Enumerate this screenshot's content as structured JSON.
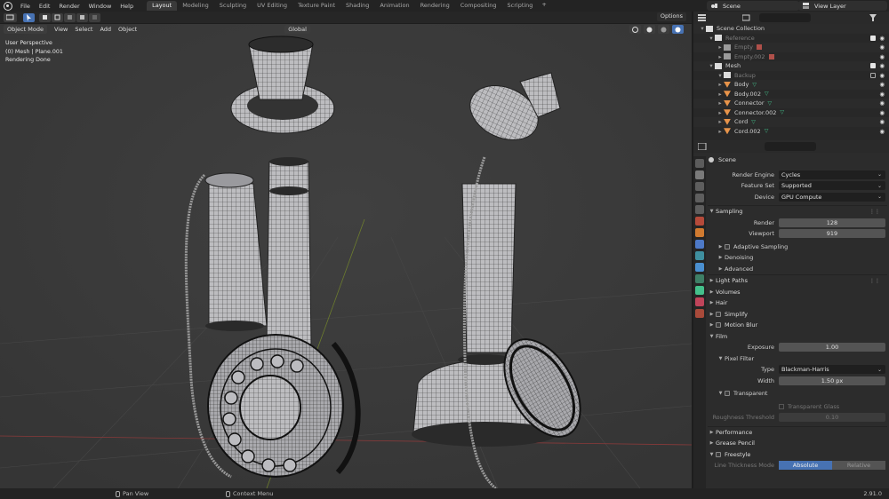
{
  "menu": [
    "File",
    "Edit",
    "Render",
    "Window",
    "Help"
  ],
  "workspaces": [
    {
      "label": "Layout",
      "active": true
    },
    {
      "label": "Modeling",
      "active": false
    },
    {
      "label": "Sculpting",
      "active": false
    },
    {
      "label": "UV Editing",
      "active": false
    },
    {
      "label": "Texture Paint",
      "active": false
    },
    {
      "label": "Shading",
      "active": false
    },
    {
      "label": "Animation",
      "active": false
    },
    {
      "label": "Rendering",
      "active": false
    },
    {
      "label": "Compositing",
      "active": false
    },
    {
      "label": "Scripting",
      "active": false
    }
  ],
  "add_tab": "+",
  "scene": "Scene",
  "view_layer": "View Layer",
  "viewport": {
    "mode": "Object Mode",
    "menus": [
      "View",
      "Select",
      "Add",
      "Object"
    ],
    "orientation": "Global",
    "options": "Options",
    "info": [
      "User Perspective",
      "(0) Mesh | Plane.001",
      "Rendering Done"
    ]
  },
  "outliner": {
    "rows": [
      {
        "label": "Scene Collection",
        "indent": 0,
        "type": "collection",
        "dim": false,
        "check": null
      },
      {
        "label": "Reference",
        "indent": 1,
        "type": "collection",
        "dim": true,
        "check": "on"
      },
      {
        "label": "Empty",
        "indent": 2,
        "type": "empty",
        "dim": true,
        "check": null
      },
      {
        "label": "Empty.002",
        "indent": 2,
        "type": "empty",
        "dim": true,
        "check": null
      },
      {
        "label": "Mesh",
        "indent": 1,
        "type": "collection",
        "dim": false,
        "check": "on"
      },
      {
        "label": "Backup",
        "indent": 2,
        "type": "collection",
        "dim": true,
        "check": "off"
      },
      {
        "label": "Body",
        "indent": 2,
        "type": "mesh",
        "dim": false,
        "check": null
      },
      {
        "label": "Body.002",
        "indent": 2,
        "type": "mesh",
        "dim": false,
        "check": null
      },
      {
        "label": "Connector",
        "indent": 2,
        "type": "mesh",
        "dim": false,
        "check": null
      },
      {
        "label": "Connector.002",
        "indent": 2,
        "type": "mesh",
        "dim": false,
        "check": null
      },
      {
        "label": "Cord",
        "indent": 2,
        "type": "mesh",
        "dim": false,
        "check": null
      },
      {
        "label": "Cord.002",
        "indent": 2,
        "type": "mesh",
        "dim": false,
        "check": null
      }
    ]
  },
  "properties": {
    "context": "Scene",
    "render_engine_label": "Render Engine",
    "render_engine": "Cycles",
    "feature_set_label": "Feature Set",
    "feature_set": "Supported",
    "device_label": "Device",
    "device": "GPU Compute",
    "sampling": "Sampling",
    "render_label": "Render",
    "render_samples": "128",
    "viewport_label": "Viewport",
    "viewport_samples": "919",
    "adaptive_sampling": "Adaptive Sampling",
    "denoising": "Denoising",
    "advanced": "Advanced",
    "light_paths": "Light Paths",
    "volumes": "Volumes",
    "hair": "Hair",
    "simplify": "Simplify",
    "motion_blur": "Motion Blur",
    "film": "Film",
    "exposure_label": "Exposure",
    "exposure": "1.00",
    "pixel_filter": "Pixel Filter",
    "type_label": "Type",
    "filter_type": "Blackman-Harris",
    "width_label": "Width",
    "width": "1.50 px",
    "transparent": "Transparent",
    "transparent_glass": "Transparent Glass",
    "roughness_label": "Roughness Threshold",
    "roughness": "0.10",
    "performance": "Performance",
    "grease_pencil": "Grease Pencil",
    "freestyle": "Freestyle",
    "line_thickness_label": "Line Thickness Mode",
    "line_thickness_options": [
      "Absolute",
      "Relative"
    ]
  },
  "status": {
    "pan": "Pan View",
    "context": "Context Menu",
    "version": "2.91.0"
  },
  "colors": {
    "accent": "#4772b3",
    "mesh_icon": "#e8944a",
    "mesh_data": "#44c08b"
  }
}
